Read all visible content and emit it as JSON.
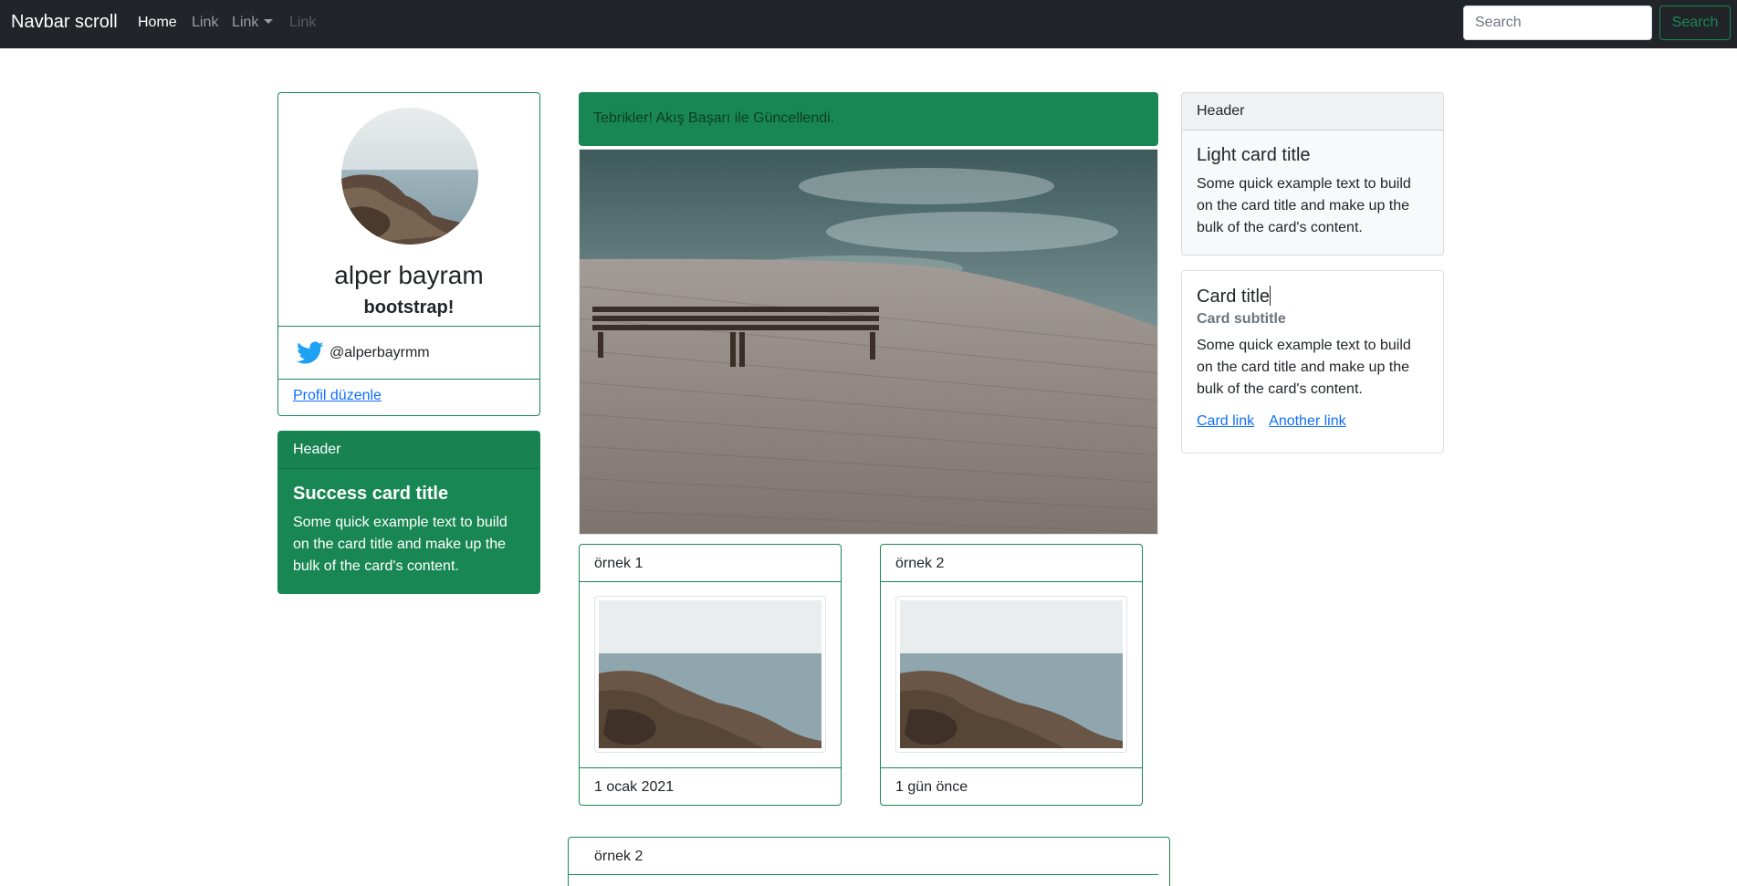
{
  "navbar": {
    "brand": "Navbar scroll",
    "links": [
      "Home",
      "Link",
      "Link",
      "Link"
    ],
    "search_placeholder": "Search",
    "search_button": "Search"
  },
  "profile": {
    "name": "alper bayram",
    "subtitle": "bootstrap!",
    "twitter_handle": "@alperbayrmm",
    "edit_link": "Profil düzenle"
  },
  "success_card": {
    "header": "Header",
    "title": "Success card title",
    "text": "Some quick example text to build on the card title and make up the bulk of the card's content."
  },
  "alert": {
    "text": "Tebrikler! Akış Başarı ile Güncellendi."
  },
  "small_cards": [
    {
      "header": "örnek 1",
      "footer": "1 ocak 2021"
    },
    {
      "header": "örnek 2",
      "footer": "1 gün önce"
    }
  ],
  "bottom_card": {
    "header": "örnek 2"
  },
  "light_card": {
    "header": "Header",
    "title": "Light card title",
    "text": "Some quick example text to build on the card title and make up the bulk of the card's content."
  },
  "plain_card": {
    "title": "Card title",
    "subtitle": "Card subtitle",
    "text": "Some quick example text to build on the card title and make up the bulk of the card's content.",
    "link1": "Card link",
    "link2": "Another link"
  },
  "colors": {
    "navbar_bg": "#212529",
    "success": "#198754",
    "link": "#0d6efd",
    "muted": "#6c757d",
    "twitter": "#1da1f2"
  }
}
